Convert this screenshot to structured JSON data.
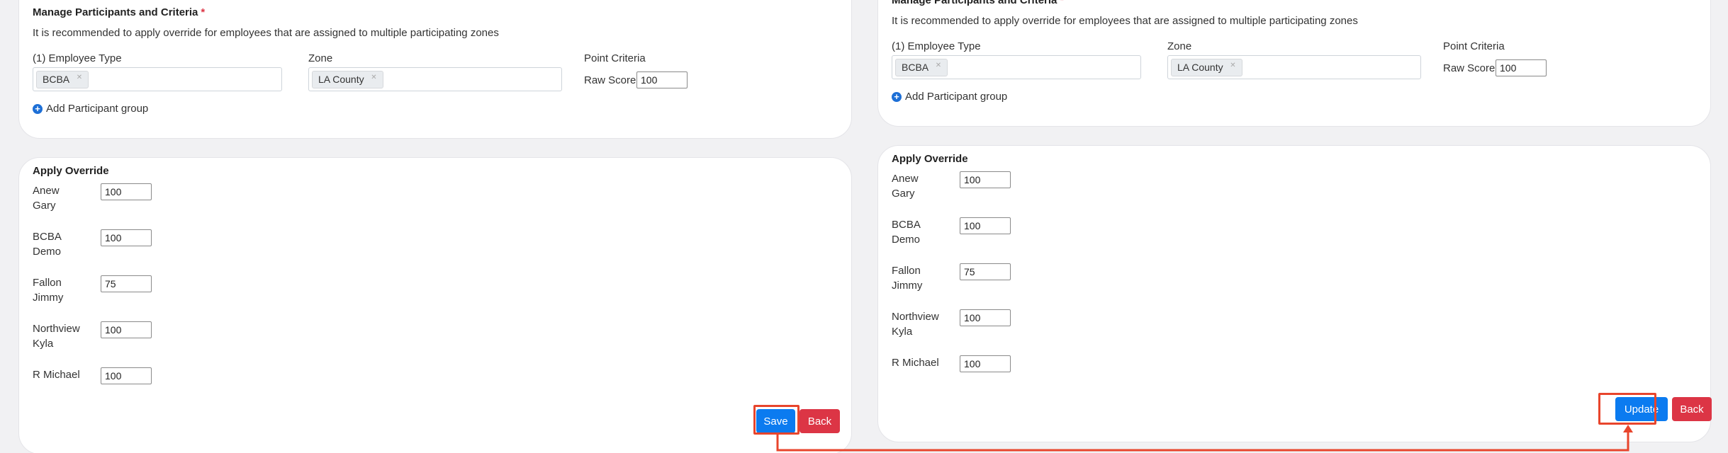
{
  "manage": {
    "title": "Manage Participants and Criteria",
    "required_mark": "*",
    "description": "It is recommended to apply override for employees that are assigned to multiple participating zones",
    "employee_type_label": "(1) Employee Type",
    "employee_type_chip": "BCBA",
    "zone_label": "Zone",
    "zone_chip": "LA County",
    "point_criteria_label": "Point Criteria",
    "raw_score_label": "Raw Score",
    "raw_score_value": "100",
    "add_group_label": "Add Participant group"
  },
  "override": {
    "title": "Apply Override",
    "rows": [
      {
        "line1": "Anew",
        "line2": "Gary",
        "value": "100"
      },
      {
        "line1": "BCBA",
        "line2": "Demo",
        "value": "100"
      },
      {
        "line1": "Fallon",
        "line2": "Jimmy",
        "value": "75"
      },
      {
        "line1": "Northview",
        "line2": "Kyla",
        "value": "100"
      },
      {
        "line1": "R Michael",
        "line2": "",
        "value": "100"
      }
    ]
  },
  "buttons": {
    "save": "Save",
    "update": "Update",
    "back": "Back"
  },
  "colors": {
    "primary": "#0b7bf0",
    "danger": "#dc3545",
    "highlight": "#e8452c"
  }
}
